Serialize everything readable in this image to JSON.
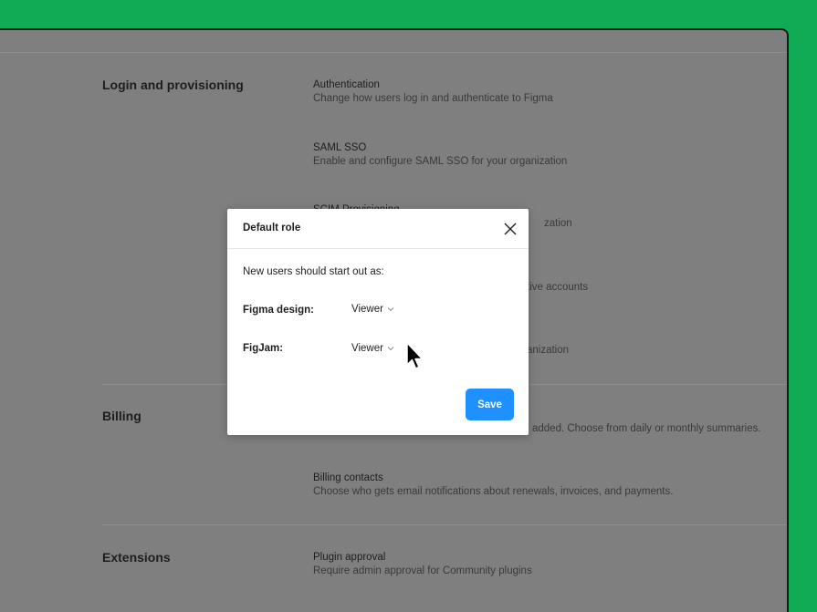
{
  "sections": {
    "login": {
      "title": "Login and provisioning",
      "items": [
        {
          "title": "Authentication",
          "desc": "Change how users log in and authenticate to Figma"
        },
        {
          "title": "SAML SSO",
          "desc": "Enable and configure SAML SSO for your organization"
        },
        {
          "title": "SCIM Provisioning",
          "desc": "zation"
        },
        {
          "title": "",
          "desc": "tive accounts"
        },
        {
          "title": "",
          "desc": "anization"
        }
      ]
    },
    "billing": {
      "title": "Billing",
      "items": [
        {
          "title": "",
          "desc": "added. Choose from daily or monthly summaries."
        },
        {
          "title": "Billing contacts",
          "desc": "Choose who gets email notifications about renewals, invoices, and payments."
        }
      ]
    },
    "extensions": {
      "title": "Extensions",
      "items": [
        {
          "title": "Plugin approval",
          "desc": "Require admin approval for Community plugins"
        }
      ]
    }
  },
  "modal": {
    "title": "Default role",
    "intro": "New users should start out as:",
    "rows": [
      {
        "label": "Figma design:",
        "value": "Viewer"
      },
      {
        "label": "FigJam:",
        "value": "Viewer"
      }
    ],
    "save_label": "Save",
    "close_icon": "close-icon"
  },
  "colors": {
    "background": "#12ab55",
    "overlay": "#7f7f7f",
    "primary": "#1e90ff"
  }
}
